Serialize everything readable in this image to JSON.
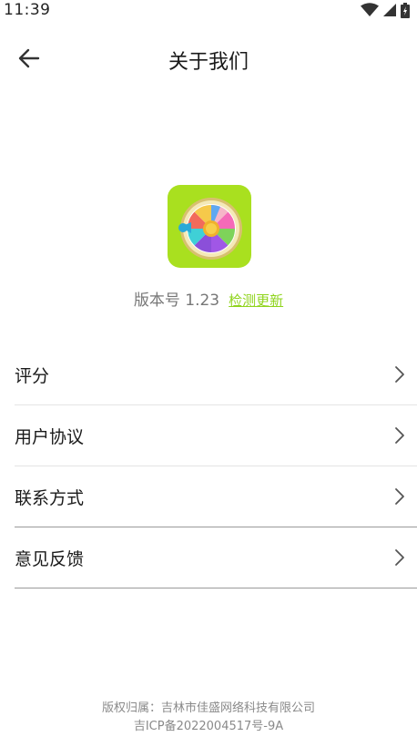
{
  "status_bar": {
    "time": "11:39",
    "icons": [
      "wifi-icon",
      "signal-icon",
      "battery-icon"
    ]
  },
  "header": {
    "back_icon": "arrow-left-icon",
    "title": "关于我们"
  },
  "app": {
    "icon": "prize-wheel-icon",
    "icon_bg_color": "#a9e01f",
    "version_label": "版本号 1.23",
    "check_update_label": "检测更新"
  },
  "menu": {
    "items": [
      {
        "label": "评分"
      },
      {
        "label": "用户协议"
      },
      {
        "label": "联系方式"
      },
      {
        "label": "意见反馈"
      }
    ],
    "chevron_icon": "chevron-right-icon"
  },
  "footer": {
    "copyright": "版权归属：吉林市佳盛网络科技有限公司",
    "icp": "吉ICP备2022004517号-9A"
  },
  "colors": {
    "accent_green": "#8fd41c",
    "text_primary": "#1a1a1a",
    "text_secondary": "#777777"
  }
}
